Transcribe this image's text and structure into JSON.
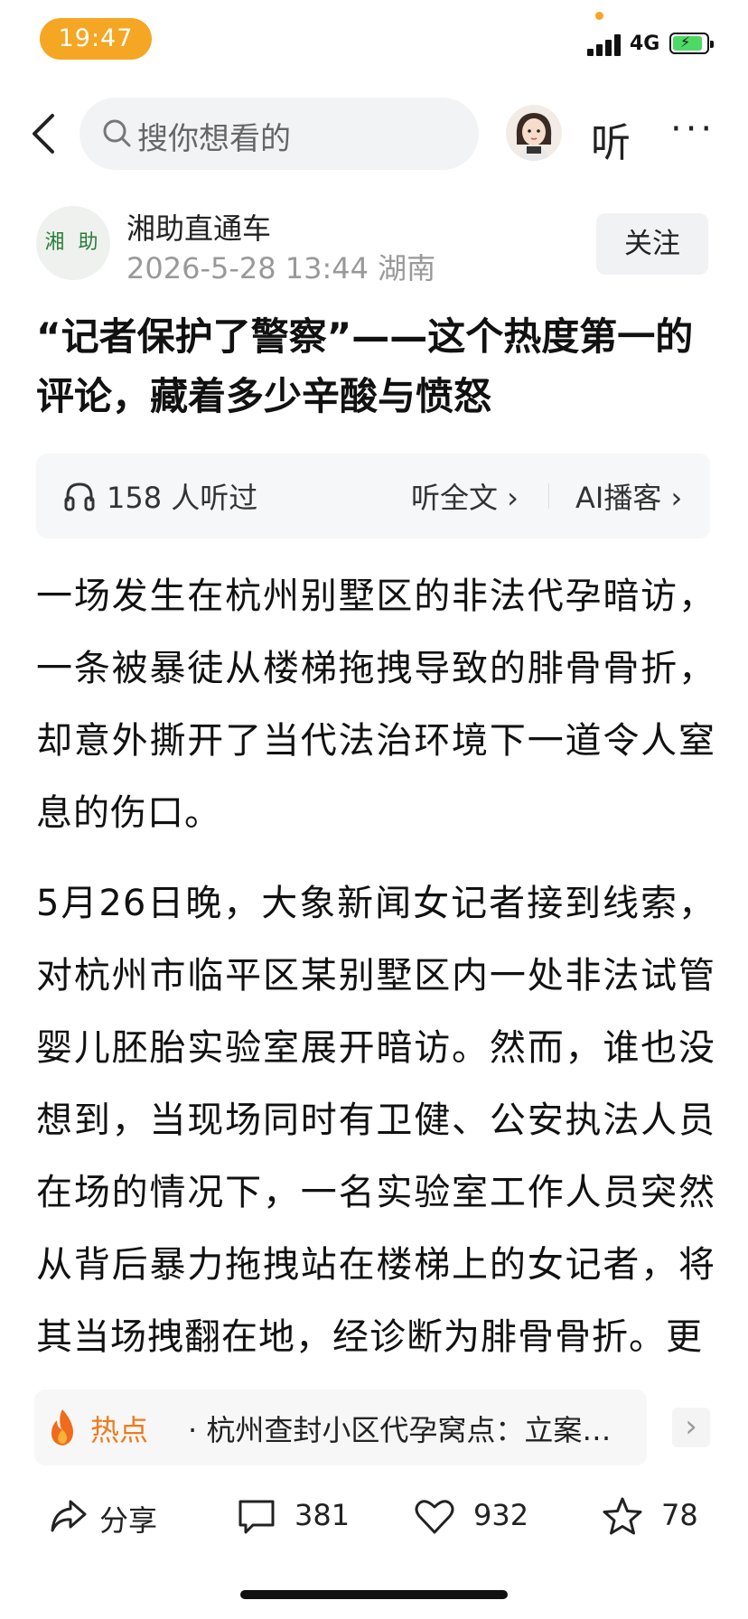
{
  "status_bar": {
    "time": "19:47",
    "network": "4G"
  },
  "nav": {
    "search_placeholder": "搜你想看的",
    "listen_label": "听",
    "more_label": "···"
  },
  "author": {
    "logo_text": "湘 助",
    "name": "湘助直通车",
    "meta": "2026-5-28 13:44 湖南",
    "follow_label": "关注"
  },
  "article": {
    "headline": "“记者保护了警察”——这个热度第一的评论，藏着多少辛酸与愤怒",
    "listen_count": "158 人听过",
    "full_text_label": "听全文 ›",
    "ai_cast_label": "AI播客 ›",
    "paragraphs": [
      "一场发生在杭州别墅区的非法代孕暗访，一条被暴徒从楼梯拖拽导致的腓骨骨折，却意外撕开了当代法治环境下一道令人窒息的伤口。",
      "5月26日晚，大象新闻女记者接到线索，对杭州市临平区某别墅区内一处非法试管婴儿胚胎实验室展开暗访。然而，谁也没想到，当现场同时有卫健、公安执法人员在场的情况下，一名实验室工作人员突然从背后暴力拖拽站在楼梯上的女记者，将其当场拽翻在地，经诊断为腓骨骨折。更"
    ]
  },
  "hot": {
    "label": "热点",
    "text": "· 杭州查封小区代孕窝点：立案…",
    "arrow": "›"
  },
  "actions": {
    "share_label": "分享",
    "comment_count": "381",
    "like_count": "932",
    "favorite_count": "78"
  },
  "colors": {
    "accent": "#f5a623",
    "hot": "#f07a1a",
    "logo_green": "#2a7d3a"
  }
}
